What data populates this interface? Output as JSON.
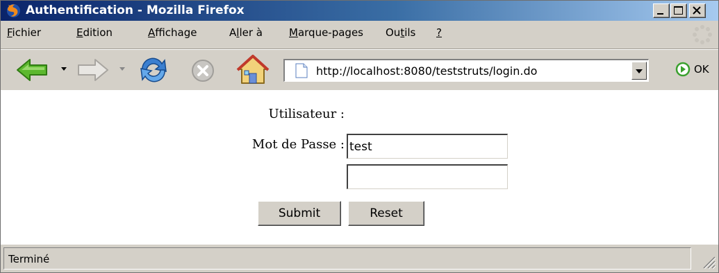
{
  "window": {
    "title": "Authentification - Mozilla Firefox",
    "controls": [
      "minimize",
      "maximize",
      "close"
    ]
  },
  "menu": {
    "items": [
      {
        "label": "Fichier",
        "accel": "F"
      },
      {
        "label": "Edition",
        "accel": "E"
      },
      {
        "label": "Affichage",
        "accel": "A"
      },
      {
        "label": "Aller à",
        "accel": "l"
      },
      {
        "label": "Marque-pages",
        "accel": "M"
      },
      {
        "label": "Outils",
        "accel": "t"
      },
      {
        "label": "?",
        "accel": "?"
      }
    ]
  },
  "toolbar": {
    "buttons": [
      "back-icon",
      "forward-icon",
      "reload-icon",
      "stop-icon",
      "home-icon"
    ],
    "url": "http://localhost:8080/teststruts/login.do",
    "go_label": "OK"
  },
  "form": {
    "user_label": "Utilisateur :",
    "user_value": "test",
    "password_label": "Mot de Passe :",
    "password_value": "",
    "submit_label": "Submit",
    "reset_label": "Reset"
  },
  "status": {
    "text": "Terminé"
  },
  "colors": {
    "titlebar_start": "#0a246a",
    "titlebar_end": "#a6caf0",
    "chrome": "#d4d0c8",
    "back_arrow": "#5cb82e",
    "reload": "#3b7fd0"
  }
}
